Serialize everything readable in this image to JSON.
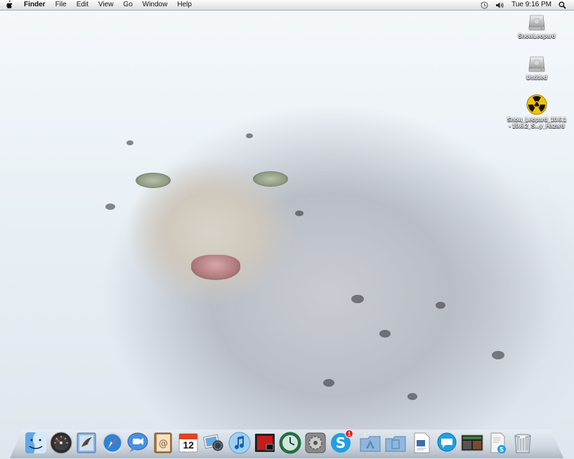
{
  "menubar": {
    "app_name": "Finder",
    "menus": [
      "File",
      "Edit",
      "View",
      "Go",
      "Window",
      "Help"
    ],
    "clock": "Tue 9:16 PM"
  },
  "desktop": {
    "icons": [
      {
        "label": "SnowLeopard",
        "icon": "hard-drive-icon"
      },
      {
        "label": "Untitled",
        "icon": "hard-drive-icon"
      },
      {
        "label": "Snow_Leopard_10.6.1\n- 10.6.2_S...y_Hazard",
        "icon": "radioactive-disk-image-icon"
      }
    ]
  },
  "dock": {
    "apps": [
      {
        "name": "Finder",
        "icon": "finder-icon"
      },
      {
        "name": "Dashboard",
        "icon": "dashboard-icon"
      },
      {
        "name": "Mail",
        "icon": "mail-icon"
      },
      {
        "name": "Safari",
        "icon": "safari-icon"
      },
      {
        "name": "iChat",
        "icon": "ichat-icon"
      },
      {
        "name": "Address Book",
        "icon": "address-book-icon"
      },
      {
        "name": "iCal",
        "icon": "ical-icon",
        "day": "12"
      },
      {
        "name": "iPhoto",
        "icon": "iphoto-icon"
      },
      {
        "name": "iTunes",
        "icon": "itunes-icon"
      },
      {
        "name": "Front Row",
        "icon": "front-row-icon"
      },
      {
        "name": "Time Machine",
        "icon": "time-machine-icon"
      },
      {
        "name": "System Preferences",
        "icon": "system-preferences-icon"
      },
      {
        "name": "Skype",
        "icon": "skype-icon",
        "badge": "1"
      }
    ],
    "documents": [
      {
        "name": "Applications",
        "icon": "applications-folder-icon"
      },
      {
        "name": "Documents",
        "icon": "documents-folder-icon"
      },
      {
        "name": "Preview",
        "icon": "document-icon"
      },
      {
        "name": "Messages",
        "icon": "speech-bubble-icon"
      },
      {
        "name": "Screen Capture",
        "icon": "screenshot-icon"
      },
      {
        "name": "Skype Installer",
        "icon": "skype-installer-icon"
      },
      {
        "name": "Trash",
        "icon": "trash-icon"
      }
    ]
  },
  "colors": {
    "menubar": "#e8e8e8",
    "skype": "#1fa0e3",
    "badge": "#e0201e",
    "radioactive": "#f2c200"
  }
}
